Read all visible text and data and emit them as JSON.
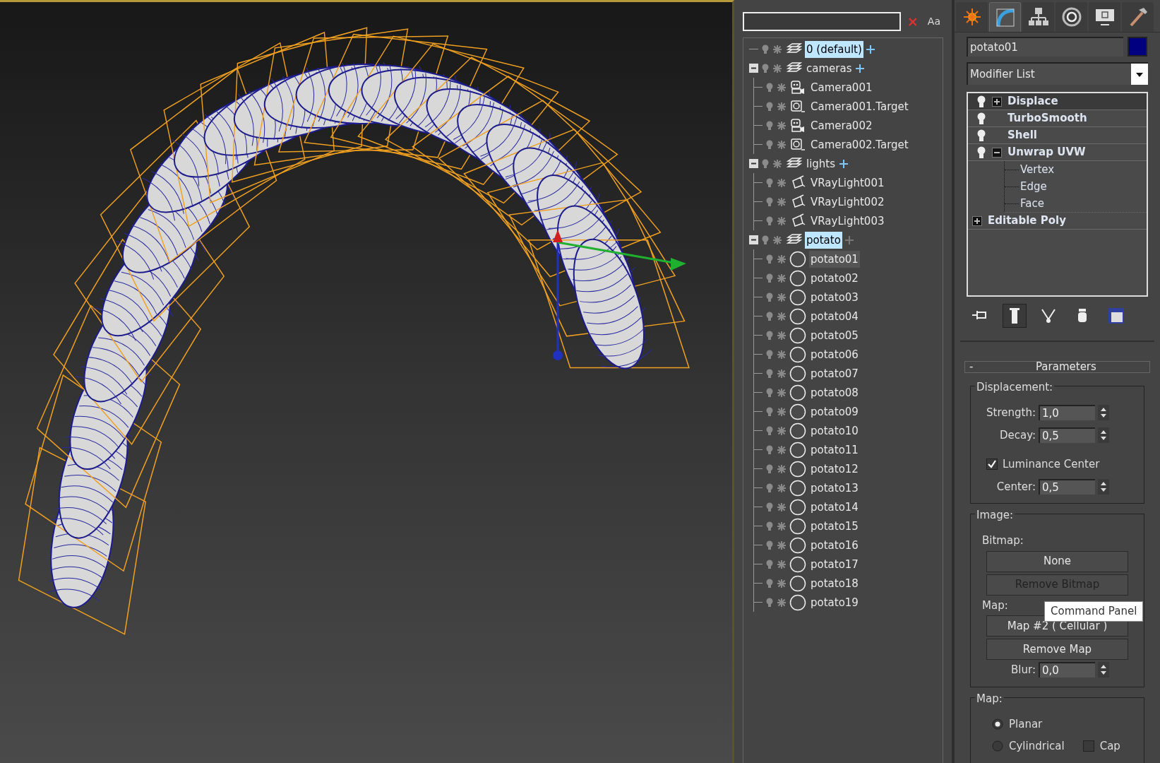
{
  "explorer": {
    "case_button": "Aa",
    "layers": [
      {
        "name": "0 (default)",
        "selected": true,
        "add_enabled": true
      },
      {
        "name": "cameras",
        "selected": false,
        "expanded": true,
        "add_enabled": true,
        "children": [
          {
            "name": "Camera001",
            "kind": "camera",
            "selected": false
          },
          {
            "name": "Camera001.Target",
            "kind": "target",
            "selected": false
          },
          {
            "name": "Camera002",
            "kind": "camera",
            "selected": false
          },
          {
            "name": "Camera002.Target",
            "kind": "target",
            "selected": false
          }
        ]
      },
      {
        "name": "lights",
        "selected": false,
        "expanded": true,
        "add_enabled": true,
        "children": [
          {
            "name": "VRayLight001",
            "kind": "light",
            "selected": false
          },
          {
            "name": "VRayLight002",
            "kind": "light",
            "selected": false
          },
          {
            "name": "VRayLight003",
            "kind": "light",
            "selected": false
          }
        ]
      },
      {
        "name": "potato",
        "selected": true,
        "expanded": true,
        "add_enabled": false,
        "children": [
          {
            "name": "potato01",
            "kind": "object",
            "selected": true
          },
          {
            "name": "potato02",
            "kind": "object",
            "selected": false
          },
          {
            "name": "potato03",
            "kind": "object",
            "selected": false
          },
          {
            "name": "potato04",
            "kind": "object",
            "selected": false
          },
          {
            "name": "potato05",
            "kind": "object",
            "selected": false
          },
          {
            "name": "potato06",
            "kind": "object",
            "selected": false
          },
          {
            "name": "potato07",
            "kind": "object",
            "selected": false
          },
          {
            "name": "potato08",
            "kind": "object",
            "selected": false
          },
          {
            "name": "potato09",
            "kind": "object",
            "selected": false
          },
          {
            "name": "potato10",
            "kind": "object",
            "selected": false
          },
          {
            "name": "potato11",
            "kind": "object",
            "selected": false
          },
          {
            "name": "potato12",
            "kind": "object",
            "selected": false
          },
          {
            "name": "potato13",
            "kind": "object",
            "selected": false
          },
          {
            "name": "potato14",
            "kind": "object",
            "selected": false
          },
          {
            "name": "potato15",
            "kind": "object",
            "selected": false
          },
          {
            "name": "potato16",
            "kind": "object",
            "selected": false
          },
          {
            "name": "potato17",
            "kind": "object",
            "selected": false
          },
          {
            "name": "potato18",
            "kind": "object",
            "selected": false
          },
          {
            "name": "potato19",
            "kind": "object",
            "selected": false
          }
        ]
      }
    ]
  },
  "command_panel": {
    "tabs": [
      {
        "kind": "create",
        "selected": false
      },
      {
        "kind": "modify",
        "selected": true
      },
      {
        "kind": "hierarchy",
        "selected": false
      },
      {
        "kind": "motion",
        "selected": false
      },
      {
        "kind": "display",
        "selected": false
      },
      {
        "kind": "utilities",
        "selected": false
      }
    ],
    "object_name": "potato01",
    "modifier_list": "Modifier List",
    "stack": [
      {
        "name": "Displace",
        "kind": "modifier",
        "selected": true,
        "expanded": false
      },
      {
        "name": "TurboSmooth",
        "kind": "modifier",
        "selected": false
      },
      {
        "name": "Shell",
        "kind": "modifier",
        "selected": false
      },
      {
        "name": "Unwrap UVW",
        "kind": "modifier",
        "selected": false,
        "expanded": true,
        "children": [
          "Vertex",
          "Edge",
          "Face"
        ]
      },
      {
        "name": "Editable Poly",
        "kind": "base",
        "selected": false,
        "expanded": false
      }
    ],
    "stack_tools": [
      {
        "kind": "pin",
        "on": false
      },
      {
        "kind": "end-result",
        "on": true
      },
      {
        "kind": "unique",
        "on": false
      },
      {
        "kind": "remove",
        "on": false
      },
      {
        "kind": "configure",
        "on": false
      }
    ],
    "rollout": {
      "collapse": "-",
      "title": "Parameters",
      "displacement": {
        "label": "Displacement:",
        "strength_label": "Strength:",
        "strength": "1,0",
        "decay_label": "Decay:",
        "decay": "0,5",
        "luminance_label": "Luminance Center",
        "luminance_checked": true,
        "center_label": "Center:",
        "center": "0,5"
      },
      "image": {
        "label": "Image:",
        "bitmap_label": "Bitmap:",
        "bitmap_button": "None",
        "remove_bitmap": "Remove Bitmap",
        "remove_bitmap_disabled": true,
        "map_label": "Map:",
        "map_button": "Map #2  ( Cellular )",
        "remove_map": "Remove Map",
        "remove_map_disabled": false,
        "blur_label": "Blur:",
        "blur": "0,0"
      },
      "map": {
        "label": "Map:",
        "options": [
          {
            "label": "Planar",
            "selected": true
          },
          {
            "label": "Cylindrical",
            "selected": false
          }
        ],
        "cap_label": "Cap",
        "cap_checked": false
      }
    },
    "tooltip": "Command Panel"
  }
}
